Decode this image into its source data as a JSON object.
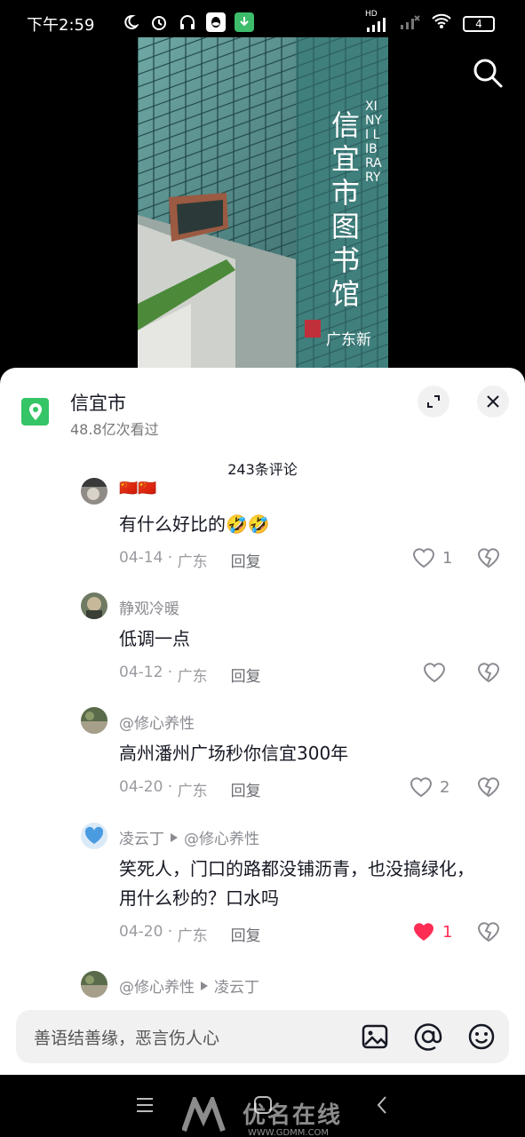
{
  "status_bar": {
    "time": "下午2:59",
    "network": "HD",
    "battery": "4"
  },
  "location": {
    "title": "信宜市",
    "views": "48.8亿次看过"
  },
  "comments_header": {
    "count_text": "243条评论"
  },
  "video": {
    "sign_text": "信宜市图书馆",
    "sign_en": "XINYI LIBRARY",
    "sign_sub": "广东新"
  },
  "comments": [
    {
      "user": "🇨🇳🇨🇳",
      "text": "有什么好比的🤣🤣",
      "date": "04-14",
      "region": "广东",
      "reply": "回复",
      "likes": "1",
      "liked": false
    },
    {
      "user": "静观冷暖",
      "text": "低调一点",
      "date": "04-12",
      "region": "广东",
      "reply": "回复",
      "likes": "",
      "liked": false
    },
    {
      "user": "@修心养性",
      "text": "高州潘州广场秒你信宜300年",
      "date": "04-20",
      "region": "广东",
      "reply": "回复",
      "likes": "2",
      "liked": false
    },
    {
      "user": "凌云丁",
      "reply_to": "@修心养性",
      "text_lines": [
        "笑死人，门口的路都没铺沥青，也没搞绿化，",
        "用什么秒的？口水吗"
      ],
      "date": "04-20",
      "region": "广东",
      "reply": "回复",
      "likes": "1",
      "liked": true
    },
    {
      "user": "@修心养性",
      "reply_to": "凌云丁"
    }
  ],
  "input": {
    "placeholder": "善语结善缘，恶言伤人心"
  },
  "watermark": {
    "brand": "优名在线",
    "url": "WWW.GDMM.COM"
  },
  "colors": {
    "accent_green": "#35c466",
    "like_red": "#fe2c55"
  }
}
